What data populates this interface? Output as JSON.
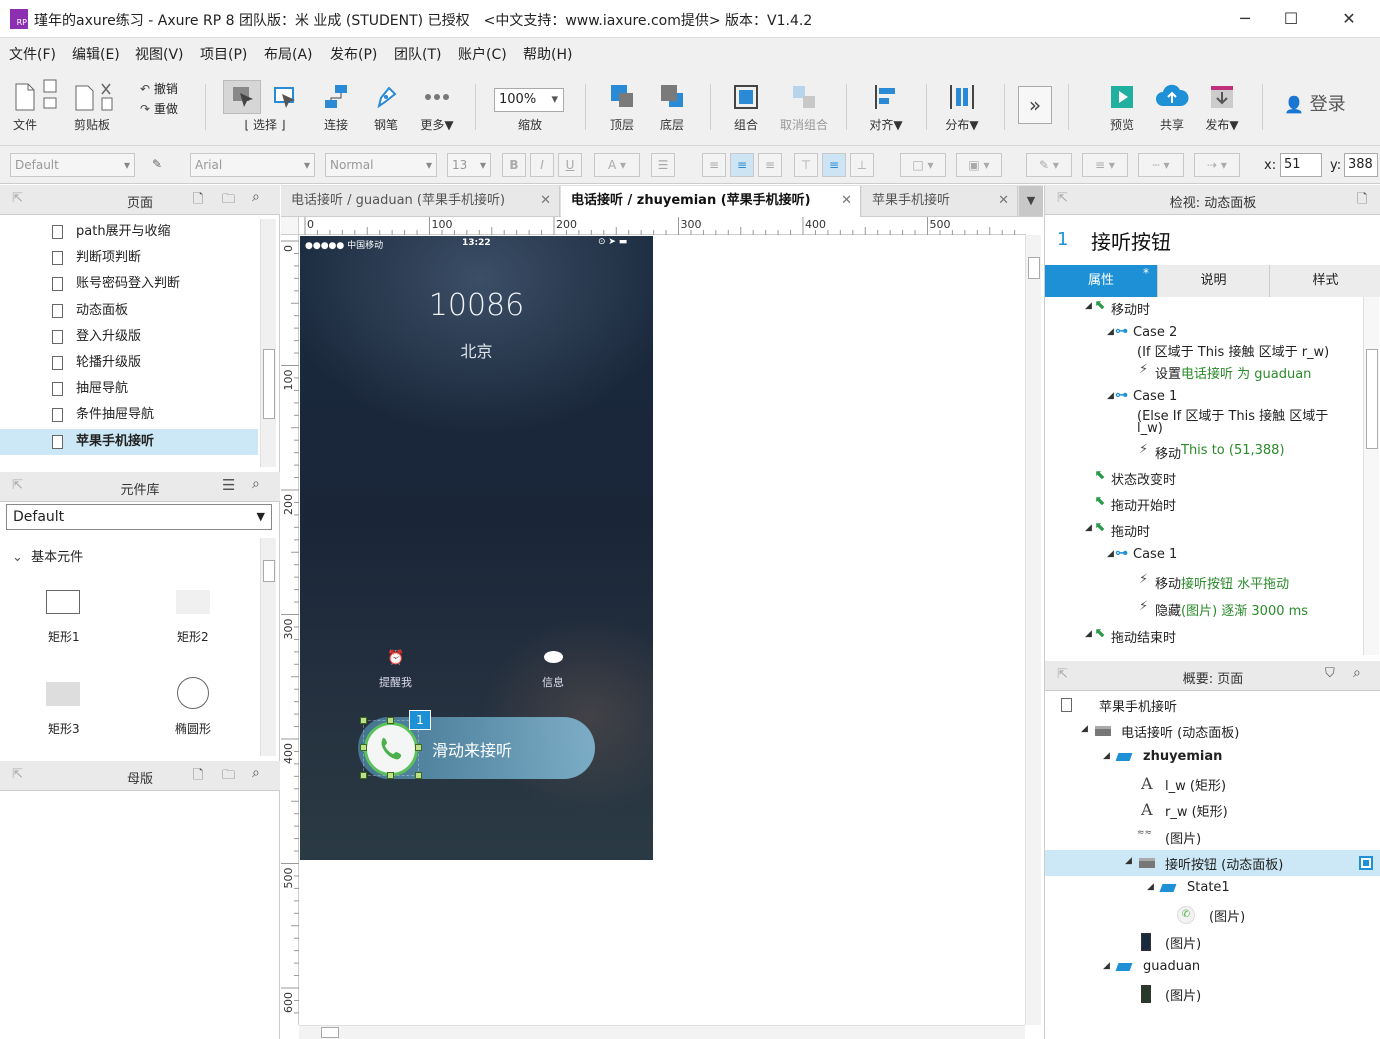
{
  "window": {
    "title": "瑾年的axure练习 - Axure RP 8 团队版：米 业成 (STUDENT) 已授权　<中文支持：www.iaxure.com提供> 版本：V1.4.2",
    "logo_text": "RP",
    "minimize": "─",
    "maximize": "☐",
    "close": "✕"
  },
  "menu": [
    "文件(F)",
    "编辑(E)",
    "视图(V)",
    "项目(P)",
    "布局(A)",
    "发布(P)",
    "团队(T)",
    "账户(C)",
    "帮助(H)"
  ],
  "toolbar": {
    "file": "文件",
    "clipboard": "剪贴板",
    "undo": "撤销",
    "redo": "重做",
    "select": "选择",
    "connect": "连接",
    "pen": "钢笔",
    "more": "更多▼",
    "zoom_value": "100%",
    "zoom_label": "缩放",
    "top": "顶层",
    "bottom": "底层",
    "group": "组合",
    "ungroup": "取消组合",
    "align": "对齐▼",
    "distribute": "分布▼",
    "preview": "预览",
    "share": "共享",
    "publish": "发布▼",
    "login": "登录"
  },
  "format": {
    "style": "Default",
    "font": "Arial",
    "weight": "Normal",
    "size": "13",
    "x_label": "x:",
    "x_value": "51",
    "y_label": "y:",
    "y_value": "388"
  },
  "pages_panel": {
    "title": "页面",
    "items": [
      "path展开与收缩",
      "判断项判断",
      "账号密码登入判断",
      "动态面板",
      "登入升级版",
      "轮播升级版",
      "抽屉导航",
      "条件抽屉导航",
      "苹果手机接听"
    ],
    "selected_index": 8
  },
  "library_panel": {
    "title": "元件库",
    "dropdown": "Default",
    "section": "基本元件",
    "widgets": [
      "矩形1",
      "矩形2",
      "矩形3",
      "椭圆形"
    ]
  },
  "masters_panel": {
    "title": "母版"
  },
  "tabs": [
    {
      "label": "电话接听 / guaduan (苹果手机接听)",
      "active": false
    },
    {
      "label": "电话接听 / zhuyemian (苹果手机接听)",
      "active": true
    },
    {
      "label": "苹果手机接听",
      "active": false
    }
  ],
  "ruler": {
    "h_ticks": [
      "0",
      "100",
      "200",
      "300",
      "400",
      "500"
    ],
    "v_ticks": [
      "0",
      "100",
      "200",
      "300",
      "400",
      "500",
      "600"
    ]
  },
  "phone": {
    "status_carrier": "●●●●● 中国移动",
    "status_time": "13:22",
    "status_right": "⊙ ➤ ▬",
    "number": "10086",
    "location": "北京",
    "remind": "提醒我",
    "message": "信息",
    "slide_text": "滑动来接听",
    "badge": "1"
  },
  "inspector": {
    "title": "检视: 动态面板",
    "index": "1",
    "name": "接听按钮",
    "tabs": [
      "属性",
      "说明",
      "样式"
    ],
    "events": [
      {
        "indent": 0,
        "icon": "event",
        "text": "移动时",
        "arrow": true
      },
      {
        "indent": 1,
        "icon": "case",
        "text": "Case 2",
        "arrow": true
      },
      {
        "indent": 1,
        "icon": "none",
        "text": "(If 区域于 This 接触 区域于 r_w)"
      },
      {
        "indent": 2,
        "icon": "action",
        "text": "设置 ",
        "green": "电话接听 为 guaduan"
      },
      {
        "indent": 1,
        "icon": "case",
        "text": "Case 1",
        "arrow": true
      },
      {
        "indent": 1,
        "icon": "none",
        "text": "(Else If 区域于 This 接触 区域于"
      },
      {
        "indent": 1,
        "icon": "none",
        "text": "l_w)"
      },
      {
        "indent": 2,
        "icon": "action",
        "text": "移动 ",
        "green": "This to (51,388)"
      },
      {
        "indent": 0,
        "icon": "event",
        "text": "状态改变时"
      },
      {
        "indent": 0,
        "icon": "event",
        "text": "拖动开始时"
      },
      {
        "indent": 0,
        "icon": "event",
        "text": "拖动时",
        "arrow": true
      },
      {
        "indent": 1,
        "icon": "case",
        "text": "Case 1",
        "arrow": true
      },
      {
        "indent": 2,
        "icon": "action",
        "text": "移动 ",
        "green": "接听按钮 水平拖动"
      },
      {
        "indent": 2,
        "icon": "action",
        "text": "隐藏 ",
        "green": "(图片) 逐渐 3000 ms"
      },
      {
        "indent": 0,
        "icon": "event",
        "text": "拖动结束时",
        "arrow": true
      }
    ]
  },
  "outline": {
    "title": "概要: 页面",
    "items": [
      {
        "indent": 0,
        "icon": "page",
        "text": "苹果手机接听"
      },
      {
        "indent": 1,
        "icon": "panel",
        "text": "电话接听 (动态面板)",
        "arrow": true
      },
      {
        "indent": 2,
        "icon": "state",
        "text": "zhuyemian",
        "arrow": true,
        "bold": true
      },
      {
        "indent": 3,
        "icon": "text",
        "text": "l_w (矩形)"
      },
      {
        "indent": 3,
        "icon": "text",
        "text": "r_w (矩形)"
      },
      {
        "indent": 3,
        "icon": "img-small",
        "text": "(图片)"
      },
      {
        "indent": 3,
        "icon": "panel",
        "text": "接听按钮 (动态面板)",
        "arrow": true,
        "selected": true
      },
      {
        "indent": 4,
        "icon": "state",
        "text": "State1",
        "arrow": true
      },
      {
        "indent": 5,
        "icon": "phone",
        "text": "(图片)"
      },
      {
        "indent": 3,
        "icon": "img-phone",
        "text": "(图片)"
      },
      {
        "indent": 2,
        "icon": "state",
        "text": "guaduan",
        "arrow": true
      },
      {
        "indent": 3,
        "icon": "img-dark",
        "text": "(图片)"
      }
    ]
  },
  "colors": {
    "accent": "#1e90d6",
    "selected_row": "#cce8f6",
    "green_text": "#2a8a2a"
  }
}
